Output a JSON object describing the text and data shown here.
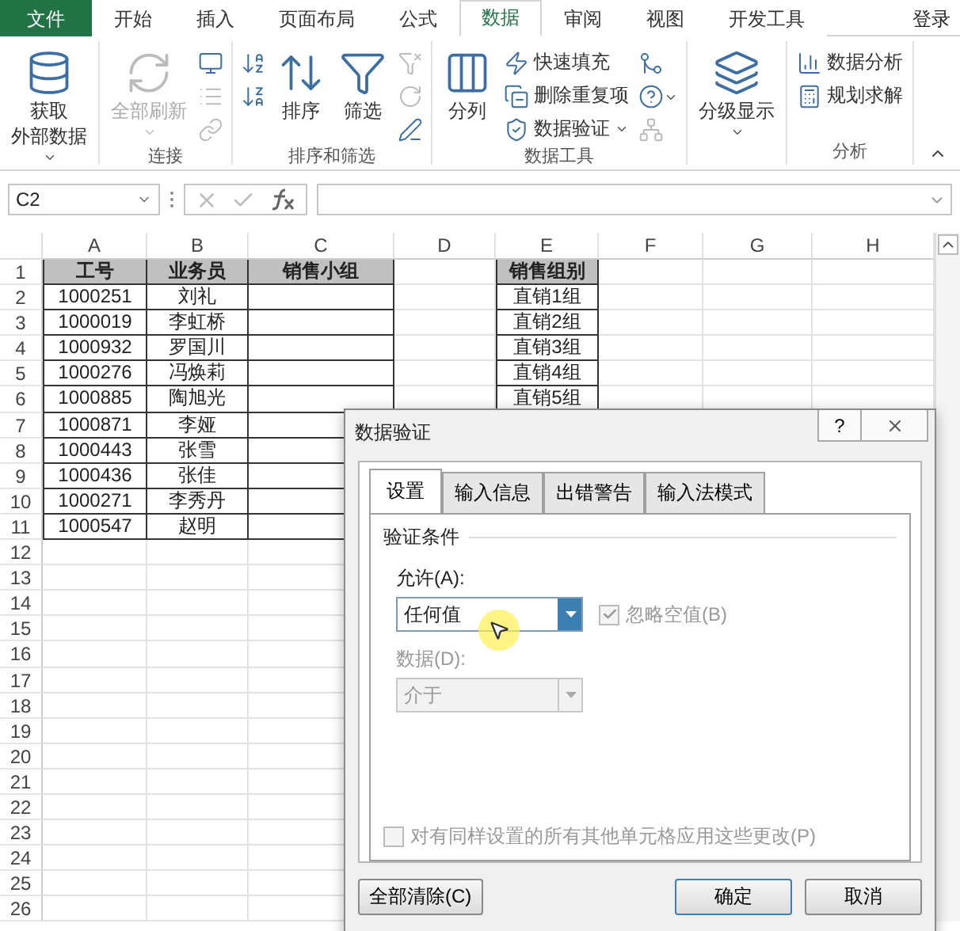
{
  "ribbon_tabs": [
    {
      "label": "文件",
      "kind": "file",
      "selected": false
    },
    {
      "label": "开始",
      "kind": "tab",
      "selected": false
    },
    {
      "label": "插入",
      "kind": "tab",
      "selected": false
    },
    {
      "label": "页面布局",
      "kind": "tab",
      "selected": false
    },
    {
      "label": "公式",
      "kind": "tab",
      "selected": false
    },
    {
      "label": "数据",
      "kind": "tab",
      "selected": true
    },
    {
      "label": "审阅",
      "kind": "tab",
      "selected": false
    },
    {
      "label": "视图",
      "kind": "tab",
      "selected": false
    },
    {
      "label": "开发工具",
      "kind": "tab",
      "selected": false
    }
  ],
  "account": "登录",
  "ribbon_groups": [
    {
      "items": [
        {
          "kind": "large",
          "lines": [
            "获取",
            "外部数据"
          ],
          "dropdown": true,
          "disabled": false
        }
      ]
    },
    {
      "label": "连接",
      "items": [
        {
          "kind": "large",
          "lines": [
            "全部刷新"
          ],
          "dropdown": true,
          "disabled": true
        },
        {
          "kind": "icons",
          "icons": [
            {
              "disabled": false
            },
            {
              "disabled": true
            },
            {
              "disabled": true
            }
          ]
        }
      ]
    },
    {
      "label": "排序和筛选",
      "items": [
        {
          "kind": "icons",
          "icons": [
            {
              "disabled": false
            },
            {
              "disabled": false
            }
          ]
        },
        {
          "kind": "large",
          "lines": [
            "排序"
          ],
          "disabled": false
        },
        {
          "kind": "large",
          "lines": [
            "筛选"
          ],
          "disabled": false
        },
        {
          "kind": "icons",
          "icons": [
            {
              "disabled": true
            },
            {
              "disabled": true
            },
            {
              "disabled": false
            }
          ]
        }
      ]
    },
    {
      "label": "数据工具",
      "items": [
        {
          "kind": "large",
          "lines": [
            "分列"
          ],
          "disabled": false
        },
        {
          "kind": "list",
          "entries": [
            {
              "label": "快速填充"
            },
            {
              "label": "删除重复项"
            },
            {
              "label": "数据验证",
              "dropdown": true
            }
          ]
        },
        {
          "kind": "icons",
          "icons": [
            {
              "disabled": false
            },
            {
              "disabled": false,
              "dropdown": true
            },
            {
              "disabled": true
            }
          ]
        }
      ]
    },
    {
      "items": [
        {
          "kind": "large",
          "lines": [
            "分级显示"
          ],
          "dropdown": true,
          "disabled": false
        }
      ]
    },
    {
      "label": "分析",
      "items": [
        {
          "kind": "list",
          "entries": [
            {
              "label": "数据分析"
            },
            {
              "label": "规划求解"
            }
          ]
        }
      ]
    }
  ],
  "name_box": "C2",
  "columns": [
    "A",
    "B",
    "C",
    "D",
    "E",
    "F",
    "G",
    "H"
  ],
  "rows": [
    {
      "num": "1",
      "cells": {
        "A": {
          "text": "工号",
          "kind": "header"
        },
        "B": {
          "text": "业务员",
          "kind": "header"
        },
        "C": {
          "text": "销售小组",
          "kind": "header"
        },
        "E": {
          "text": "销售组别",
          "kind": "header"
        }
      }
    },
    {
      "num": "2",
      "cells": {
        "A": {
          "text": "1000251",
          "kind": "data"
        },
        "B": {
          "text": "刘礼",
          "kind": "data"
        },
        "C": {
          "kind": "data"
        },
        "E": {
          "text": "直销1组",
          "kind": "data"
        }
      }
    },
    {
      "num": "3",
      "cells": {
        "A": {
          "text": "1000019",
          "kind": "data"
        },
        "B": {
          "text": "李虹桥",
          "kind": "data"
        },
        "C": {
          "kind": "data"
        },
        "E": {
          "text": "直销2组",
          "kind": "data"
        }
      }
    },
    {
      "num": "4",
      "cells": {
        "A": {
          "text": "1000932",
          "kind": "data"
        },
        "B": {
          "text": "罗国川",
          "kind": "data"
        },
        "C": {
          "kind": "data"
        },
        "E": {
          "text": "直销3组",
          "kind": "data"
        }
      }
    },
    {
      "num": "5",
      "cells": {
        "A": {
          "text": "1000276",
          "kind": "data"
        },
        "B": {
          "text": "冯焕莉",
          "kind": "data"
        },
        "C": {
          "kind": "data"
        },
        "E": {
          "text": "直销4组",
          "kind": "data"
        }
      }
    },
    {
      "num": "6",
      "cells": {
        "A": {
          "text": "1000885",
          "kind": "data"
        },
        "B": {
          "text": "陶旭光",
          "kind": "data"
        },
        "C": {
          "kind": "data"
        },
        "E": {
          "text": "直销5组",
          "kind": "data"
        }
      }
    },
    {
      "num": "7",
      "cells": {
        "A": {
          "text": "1000871",
          "kind": "data"
        },
        "B": {
          "text": "李娅",
          "kind": "data"
        },
        "C": {
          "kind": "data"
        }
      }
    },
    {
      "num": "8",
      "cells": {
        "A": {
          "text": "1000443",
          "kind": "data"
        },
        "B": {
          "text": "张雪",
          "kind": "data"
        },
        "C": {
          "kind": "data"
        }
      }
    },
    {
      "num": "9",
      "cells": {
        "A": {
          "text": "1000436",
          "kind": "data"
        },
        "B": {
          "text": "张佳",
          "kind": "data"
        },
        "C": {
          "kind": "data"
        }
      }
    },
    {
      "num": "10",
      "cells": {
        "A": {
          "text": "1000271",
          "kind": "data"
        },
        "B": {
          "text": "李秀丹",
          "kind": "data"
        },
        "C": {
          "kind": "data"
        }
      }
    },
    {
      "num": "11",
      "cells": {
        "A": {
          "text": "1000547",
          "kind": "data"
        },
        "B": {
          "text": "赵明",
          "kind": "data"
        },
        "C": {
          "kind": "data"
        }
      }
    },
    {
      "num": "12",
      "cells": {}
    },
    {
      "num": "13",
      "cells": {}
    },
    {
      "num": "14",
      "cells": {}
    },
    {
      "num": "15",
      "cells": {}
    },
    {
      "num": "16",
      "cells": {}
    },
    {
      "num": "17",
      "cells": {}
    },
    {
      "num": "18",
      "cells": {}
    },
    {
      "num": "19",
      "cells": {}
    },
    {
      "num": "20",
      "cells": {}
    },
    {
      "num": "21",
      "cells": {}
    },
    {
      "num": "22",
      "cells": {}
    },
    {
      "num": "23",
      "cells": {}
    },
    {
      "num": "24",
      "cells": {}
    },
    {
      "num": "25",
      "cells": {}
    },
    {
      "num": "26",
      "cells": {}
    }
  ],
  "dialog": {
    "title": "数据验证",
    "help": "?",
    "tabs": [
      {
        "label": "设置",
        "selected": true
      },
      {
        "label": "输入信息",
        "selected": false
      },
      {
        "label": "出错警告",
        "selected": false
      },
      {
        "label": "输入法模式",
        "selected": false
      }
    ],
    "section": "验证条件",
    "allow": {
      "label": "允许(A):",
      "value": "任何值",
      "disabled": false
    },
    "ignore_blank": {
      "label": "忽略空值(B)",
      "checked": true,
      "disabled": true
    },
    "data": {
      "label": "数据(D):",
      "value": "介于",
      "disabled": true
    },
    "apply_all": {
      "label": "对有同样设置的所有其他单元格应用这些更改(P)",
      "checked": false,
      "disabled": true
    },
    "buttons": [
      {
        "label": "全部清除(C)",
        "kind": "clear"
      },
      {
        "label": "确定",
        "kind": "ok"
      },
      {
        "label": "取消",
        "kind": "cancel"
      }
    ]
  }
}
